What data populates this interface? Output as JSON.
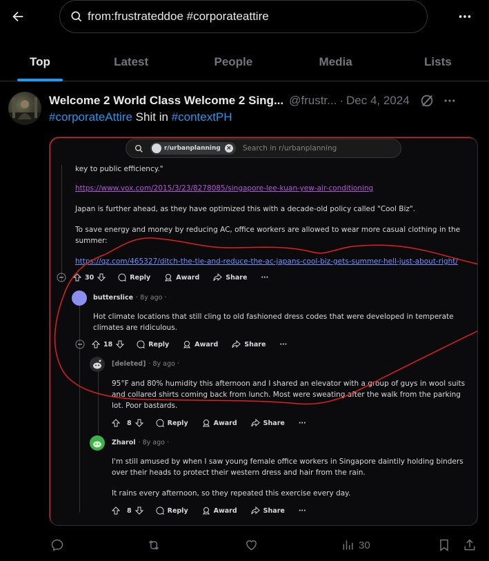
{
  "search": {
    "query": "from:frustrateddoe #corporateattire"
  },
  "tabs": [
    {
      "label": "Top",
      "active": true
    },
    {
      "label": "Latest"
    },
    {
      "label": "People"
    },
    {
      "label": "Media"
    },
    {
      "label": "Lists"
    }
  ],
  "post": {
    "name": "Welcome 2 World Class Welcome 2 Sing...",
    "handle": "@frustr...",
    "separator": "·",
    "date": "Dec 4, 2024",
    "text": {
      "hashtag1": "#corporateAttire",
      "middle": " Shit in ",
      "hashtag2": "#contextPH"
    },
    "stats": {
      "views": "30"
    }
  },
  "reddit": {
    "search_chip": "r/urbanplanning",
    "search_placeholder": "Search in r/urbanplanning",
    "c0_line1": "key to public efficiency.\"",
    "c0_link1": "https://www.vox.com/2015/3/23/8278085/singapore-lee-kuan-yew-air-conditioning",
    "c0_para2": "Japan is further ahead, as they have optimized this with a decade-old policy called \"Cool Biz\".",
    "c0_para3": "To save energy and money by reducing AC, office workers are allowed to wear more casual clothing in the summer:",
    "c0_link2": "https://qz.com/465327/ditch-the-tie-and-reduce-the-ac-japans-cool-biz-gets-summer-hell-just-about-right/",
    "c0_votes": "30",
    "reply": "Reply",
    "award": "Award",
    "share": "Share",
    "more": "···",
    "c1_user": "butterslice",
    "c1_ago": "· 8y ago ·",
    "c1_text": "Hot climate locations that still cling to old fashioned dress codes that were developed in temperate climates are ridiculous.",
    "c1_votes": "18",
    "c2_user": "[deleted]",
    "c2_ago": "· 8y ago ·",
    "c2_text": "95°F and 80% humidity this afternoon and I shared an elevator with a group of guys in wool suits and collared shirts coming back from lunch. Most were sweating after the walk from the parking lot. Poor bastards.",
    "c2_votes": "8",
    "c3_user": "Zharol",
    "c3_ago": "· 8y ago ·",
    "c3_text1": "I'm still amused by when I saw young female office workers in Singapore daintily holding binders over their heads to protect their western dress and hair from the rain.",
    "c3_text2": "It rains every afternoon, so they repeated this exercise every day.",
    "c3_votes": "8"
  },
  "colors": {
    "accent": "#1d9bf0",
    "annotation": "#e0211f",
    "link_purple": "#b357d9",
    "link_blue": "#7193ff"
  }
}
